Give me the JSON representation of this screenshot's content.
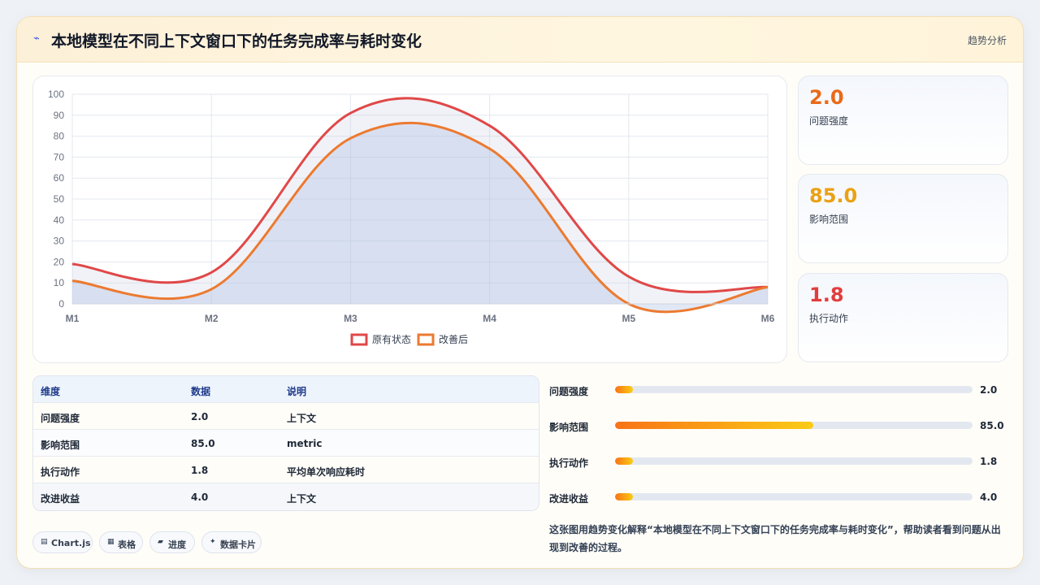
{
  "header": {
    "title": "本地模型在不同上下文窗口下的任务完成率与耗时变化",
    "tag": "趋势分析"
  },
  "stats": [
    {
      "value": "2.0",
      "label": "问题强度",
      "color": "#ea6a17"
    },
    {
      "value": "85.0",
      "label": "影响范围",
      "color": "#eaa114"
    },
    {
      "value": "1.8",
      "label": "执行动作",
      "color": "#e23d3d"
    }
  ],
  "table": {
    "headers": [
      "维度",
      "数据",
      "说明"
    ],
    "rows": [
      [
        "问题强度",
        "2.0",
        "上下文"
      ],
      [
        "影响范围",
        "85.0",
        "metric"
      ],
      [
        "执行动作",
        "1.8",
        "平均单次响应耗时"
      ],
      [
        "改进收益",
        "4.0",
        "上下文"
      ]
    ]
  },
  "bars": [
    {
      "label": "问题强度",
      "value": "2.0",
      "fraction": 0.02
    },
    {
      "label": "影响范围",
      "value": "85.0",
      "fraction": 0.555
    },
    {
      "label": "执行动作",
      "value": "1.8",
      "fraction": 0.018
    },
    {
      "label": "改进收益",
      "value": "4.0",
      "fraction": 0.04
    }
  ],
  "pills": [
    {
      "icon": "▤",
      "label": "Chart.js"
    },
    {
      "icon": "▦",
      "label": "表格"
    },
    {
      "icon": "▰",
      "label": "进度"
    },
    {
      "icon": "✦",
      "label": "数据卡片"
    }
  ],
  "description": "这张图用趋势变化解释“本地模型在不同上下文窗口下的任务完成率与耗时变化”，帮助读者看到问题从出现到改善的过程。",
  "chart_data": {
    "type": "area",
    "categories": [
      "M1",
      "M2",
      "M3",
      "M4",
      "M5",
      "M6"
    ],
    "series": [
      {
        "name": "原有状态",
        "values": [
          19,
          15,
          91,
          85,
          13,
          8
        ],
        "color": "#e04848"
      },
      {
        "name": "改善后",
        "values": [
          11,
          7,
          79,
          74,
          0,
          8
        ],
        "color": "#ec7a30"
      }
    ],
    "ylim": [
      0,
      100
    ],
    "yticks": [
      "0",
      "10",
      "20",
      "30",
      "40",
      "50",
      "60",
      "70",
      "80",
      "90",
      "100"
    ],
    "grid": true,
    "legend": "bottom"
  }
}
